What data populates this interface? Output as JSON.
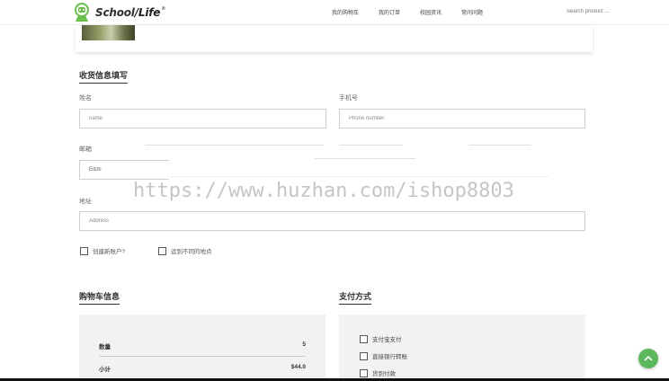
{
  "header": {
    "logo_school": "School",
    "logo_life": "Life",
    "logo_reg": "®",
    "nav_items": [
      "我的购物车",
      "我的订单",
      "校园资讯",
      "常问问题"
    ],
    "search_placeholder": "Search product ...",
    "brand_color": "#5cb85c"
  },
  "shipping": {
    "title": "收货信息填写",
    "name_label": "姓名",
    "name_placeholder": "name",
    "phone_label": "手机号",
    "phone_placeholder": "Phone number",
    "email_label": "邮箱",
    "email_value": "Edds",
    "address_label": "地址",
    "address_placeholder": "Address",
    "create_account_label": "创建新账户?",
    "ship_different_label": "运到不同的地点"
  },
  "watermark": "https://www.huzhan.com/ishop8803",
  "cart": {
    "title": "购物车信息",
    "rows": [
      {
        "label": "数量",
        "value": "5"
      },
      {
        "label": "小计",
        "value": "$44.0"
      }
    ]
  },
  "payment": {
    "title": "支付方式",
    "options": [
      "支付宝支付",
      "直接银行转账",
      "货到付款"
    ]
  },
  "icons": {
    "logo": "robot-mascot-icon",
    "to_top": "chevron-up-icon"
  }
}
